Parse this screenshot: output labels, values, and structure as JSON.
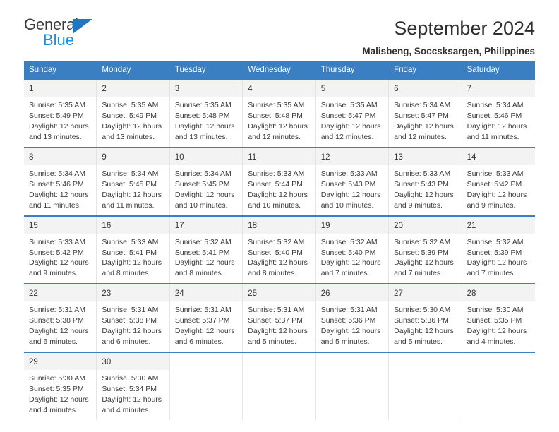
{
  "brand": {
    "name_top": "General",
    "name_bottom": "Blue",
    "accent_color": "#1f8fe0",
    "triangle_color": "#1f77c4"
  },
  "header": {
    "title": "September 2024",
    "subtitle": "Malisbeng, Soccsksargen, Philippines"
  },
  "calendar": {
    "header_bg": "#3a7fc1",
    "daynum_band_bg": "#f3f3f3",
    "weekdays": [
      "Sunday",
      "Monday",
      "Tuesday",
      "Wednesday",
      "Thursday",
      "Friday",
      "Saturday"
    ],
    "labels": {
      "sunrise": "Sunrise:",
      "sunset": "Sunset:",
      "daylight": "Daylight:"
    },
    "weeks": [
      [
        {
          "day": "1",
          "sunrise": "Sunrise: 5:35 AM",
          "sunset": "Sunset: 5:49 PM",
          "daylight": "Daylight: 12 hours and 13 minutes."
        },
        {
          "day": "2",
          "sunrise": "Sunrise: 5:35 AM",
          "sunset": "Sunset: 5:49 PM",
          "daylight": "Daylight: 12 hours and 13 minutes."
        },
        {
          "day": "3",
          "sunrise": "Sunrise: 5:35 AM",
          "sunset": "Sunset: 5:48 PM",
          "daylight": "Daylight: 12 hours and 13 minutes."
        },
        {
          "day": "4",
          "sunrise": "Sunrise: 5:35 AM",
          "sunset": "Sunset: 5:48 PM",
          "daylight": "Daylight: 12 hours and 12 minutes."
        },
        {
          "day": "5",
          "sunrise": "Sunrise: 5:35 AM",
          "sunset": "Sunset: 5:47 PM",
          "daylight": "Daylight: 12 hours and 12 minutes."
        },
        {
          "day": "6",
          "sunrise": "Sunrise: 5:34 AM",
          "sunset": "Sunset: 5:47 PM",
          "daylight": "Daylight: 12 hours and 12 minutes."
        },
        {
          "day": "7",
          "sunrise": "Sunrise: 5:34 AM",
          "sunset": "Sunset: 5:46 PM",
          "daylight": "Daylight: 12 hours and 11 minutes."
        }
      ],
      [
        {
          "day": "8",
          "sunrise": "Sunrise: 5:34 AM",
          "sunset": "Sunset: 5:46 PM",
          "daylight": "Daylight: 12 hours and 11 minutes."
        },
        {
          "day": "9",
          "sunrise": "Sunrise: 5:34 AM",
          "sunset": "Sunset: 5:45 PM",
          "daylight": "Daylight: 12 hours and 11 minutes."
        },
        {
          "day": "10",
          "sunrise": "Sunrise: 5:34 AM",
          "sunset": "Sunset: 5:45 PM",
          "daylight": "Daylight: 12 hours and 10 minutes."
        },
        {
          "day": "11",
          "sunrise": "Sunrise: 5:33 AM",
          "sunset": "Sunset: 5:44 PM",
          "daylight": "Daylight: 12 hours and 10 minutes."
        },
        {
          "day": "12",
          "sunrise": "Sunrise: 5:33 AM",
          "sunset": "Sunset: 5:43 PM",
          "daylight": "Daylight: 12 hours and 10 minutes."
        },
        {
          "day": "13",
          "sunrise": "Sunrise: 5:33 AM",
          "sunset": "Sunset: 5:43 PM",
          "daylight": "Daylight: 12 hours and 9 minutes."
        },
        {
          "day": "14",
          "sunrise": "Sunrise: 5:33 AM",
          "sunset": "Sunset: 5:42 PM",
          "daylight": "Daylight: 12 hours and 9 minutes."
        }
      ],
      [
        {
          "day": "15",
          "sunrise": "Sunrise: 5:33 AM",
          "sunset": "Sunset: 5:42 PM",
          "daylight": "Daylight: 12 hours and 9 minutes."
        },
        {
          "day": "16",
          "sunrise": "Sunrise: 5:33 AM",
          "sunset": "Sunset: 5:41 PM",
          "daylight": "Daylight: 12 hours and 8 minutes."
        },
        {
          "day": "17",
          "sunrise": "Sunrise: 5:32 AM",
          "sunset": "Sunset: 5:41 PM",
          "daylight": "Daylight: 12 hours and 8 minutes."
        },
        {
          "day": "18",
          "sunrise": "Sunrise: 5:32 AM",
          "sunset": "Sunset: 5:40 PM",
          "daylight": "Daylight: 12 hours and 8 minutes."
        },
        {
          "day": "19",
          "sunrise": "Sunrise: 5:32 AM",
          "sunset": "Sunset: 5:40 PM",
          "daylight": "Daylight: 12 hours and 7 minutes."
        },
        {
          "day": "20",
          "sunrise": "Sunrise: 5:32 AM",
          "sunset": "Sunset: 5:39 PM",
          "daylight": "Daylight: 12 hours and 7 minutes."
        },
        {
          "day": "21",
          "sunrise": "Sunrise: 5:32 AM",
          "sunset": "Sunset: 5:39 PM",
          "daylight": "Daylight: 12 hours and 7 minutes."
        }
      ],
      [
        {
          "day": "22",
          "sunrise": "Sunrise: 5:31 AM",
          "sunset": "Sunset: 5:38 PM",
          "daylight": "Daylight: 12 hours and 6 minutes."
        },
        {
          "day": "23",
          "sunrise": "Sunrise: 5:31 AM",
          "sunset": "Sunset: 5:38 PM",
          "daylight": "Daylight: 12 hours and 6 minutes."
        },
        {
          "day": "24",
          "sunrise": "Sunrise: 5:31 AM",
          "sunset": "Sunset: 5:37 PM",
          "daylight": "Daylight: 12 hours and 6 minutes."
        },
        {
          "day": "25",
          "sunrise": "Sunrise: 5:31 AM",
          "sunset": "Sunset: 5:37 PM",
          "daylight": "Daylight: 12 hours and 5 minutes."
        },
        {
          "day": "26",
          "sunrise": "Sunrise: 5:31 AM",
          "sunset": "Sunset: 5:36 PM",
          "daylight": "Daylight: 12 hours and 5 minutes."
        },
        {
          "day": "27",
          "sunrise": "Sunrise: 5:30 AM",
          "sunset": "Sunset: 5:36 PM",
          "daylight": "Daylight: 12 hours and 5 minutes."
        },
        {
          "day": "28",
          "sunrise": "Sunrise: 5:30 AM",
          "sunset": "Sunset: 5:35 PM",
          "daylight": "Daylight: 12 hours and 4 minutes."
        }
      ],
      [
        {
          "day": "29",
          "sunrise": "Sunrise: 5:30 AM",
          "sunset": "Sunset: 5:35 PM",
          "daylight": "Daylight: 12 hours and 4 minutes."
        },
        {
          "day": "30",
          "sunrise": "Sunrise: 5:30 AM",
          "sunset": "Sunset: 5:34 PM",
          "daylight": "Daylight: 12 hours and 4 minutes."
        },
        {
          "day": "",
          "sunrise": "",
          "sunset": "",
          "daylight": ""
        },
        {
          "day": "",
          "sunrise": "",
          "sunset": "",
          "daylight": ""
        },
        {
          "day": "",
          "sunrise": "",
          "sunset": "",
          "daylight": ""
        },
        {
          "day": "",
          "sunrise": "",
          "sunset": "",
          "daylight": ""
        },
        {
          "day": "",
          "sunrise": "",
          "sunset": "",
          "daylight": ""
        }
      ]
    ]
  }
}
